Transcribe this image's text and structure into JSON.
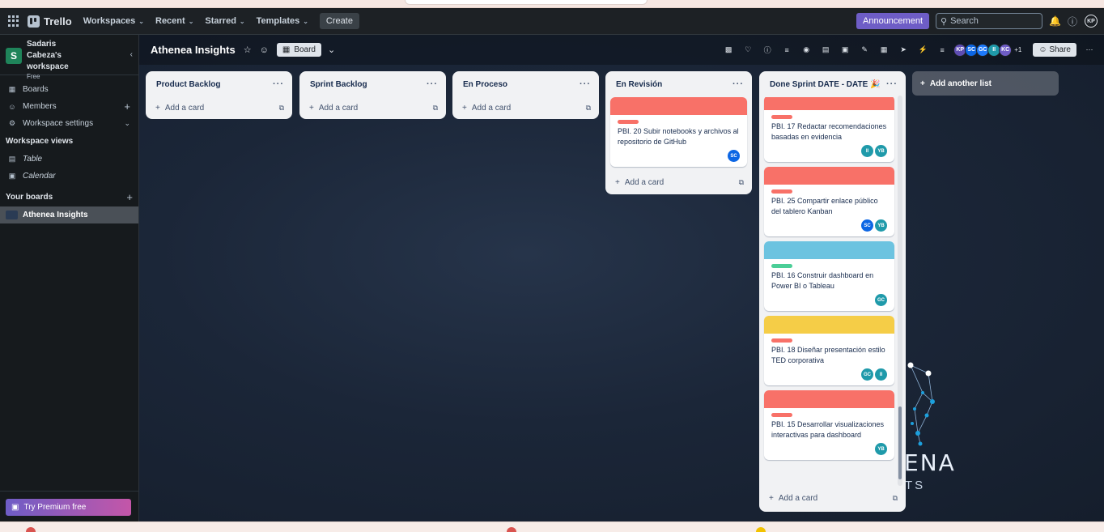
{
  "topnav": {
    "app_name": "Trello",
    "items": [
      {
        "label": "Workspaces"
      },
      {
        "label": "Recent"
      },
      {
        "label": "Starred"
      },
      {
        "label": "Templates"
      }
    ],
    "create_label": "Create",
    "announcement_label": "Announcement",
    "search_placeholder": "Search",
    "user_initials": "KP"
  },
  "sidebar": {
    "workspace_name": "Sadaris Cabeza's workspace",
    "workspace_initial": "S",
    "workspace_plan": "Free",
    "items": [
      {
        "label": "Boards"
      },
      {
        "label": "Members"
      },
      {
        "label": "Workspace settings"
      }
    ],
    "views_header": "Workspace views",
    "views": [
      {
        "label": "Table"
      },
      {
        "label": "Calendar"
      }
    ],
    "boards_header": "Your boards",
    "boards": [
      {
        "label": "Athenea Insights"
      }
    ],
    "premium_label": "Try Premium free"
  },
  "board": {
    "title": "Athenea Insights",
    "view_label": "Board",
    "members": [
      {
        "initials": "KP",
        "color": "#5e4db2"
      },
      {
        "initials": "SC",
        "color": "#0c66e4"
      },
      {
        "initials": "GC",
        "color": "#1d7afc"
      },
      {
        "initials": "II",
        "color": "#1f9aaa"
      },
      {
        "initials": "KC",
        "color": "#6e5dc6"
      }
    ],
    "members_extra": "+1",
    "share_label": "Share",
    "add_list_label": "Add another list",
    "add_card_label": "Add a card",
    "logo_text": "ENA",
    "logo_sub": "TS"
  },
  "lists": [
    {
      "title": "Product Backlog",
      "cards": []
    },
    {
      "title": "Sprint Backlog",
      "cards": []
    },
    {
      "title": "En Proceso",
      "cards": []
    },
    {
      "title": "En Revisión",
      "cards": [
        {
          "title": "PBI. 20 Subir notebooks y archivos al repositorio de GitHub",
          "cover": "#f87168",
          "label": "#f87168",
          "members": [
            {
              "initials": "SC",
              "color": "#0c66e4"
            }
          ]
        }
      ]
    },
    {
      "title": "Done Sprint DATE - DATE 🎉",
      "cards": [
        {
          "title": "PBI. 17 Redactar recomendaciones basadas en evidencia",
          "cover": "#f87168",
          "label": "#f87168",
          "members": [
            {
              "initials": "II",
              "color": "#1f9aaa"
            },
            {
              "initials": "YB",
              "color": "#1f9aaa"
            }
          ]
        },
        {
          "title": "PBI. 25 Compartir enlace público del tablero Kanban",
          "cover": "#f87168",
          "label": "#f87168",
          "members": [
            {
              "initials": "SC",
              "color": "#0c66e4"
            },
            {
              "initials": "YB",
              "color": "#1f9aaa"
            }
          ]
        },
        {
          "title": "PBI. 16 Construir dashboard en Power BI o Tableau",
          "cover": "#6cc3e0",
          "label": "#4bce97",
          "members": [
            {
              "initials": "GC",
              "color": "#1f9aaa"
            }
          ]
        },
        {
          "title": "PBI. 18 Diseñar presentación estilo TED corporativa",
          "cover": "#f5cd47",
          "label": "#f87168",
          "members": [
            {
              "initials": "GC",
              "color": "#1f9aaa"
            },
            {
              "initials": "II",
              "color": "#1f9aaa"
            }
          ]
        },
        {
          "title": "PBI. 15 Desarrollar visualizaciones interactivas para dashboard",
          "cover": "#f87168",
          "label": "#f87168",
          "members": [
            {
              "initials": "YB",
              "color": "#1f9aaa"
            }
          ]
        }
      ]
    }
  ]
}
